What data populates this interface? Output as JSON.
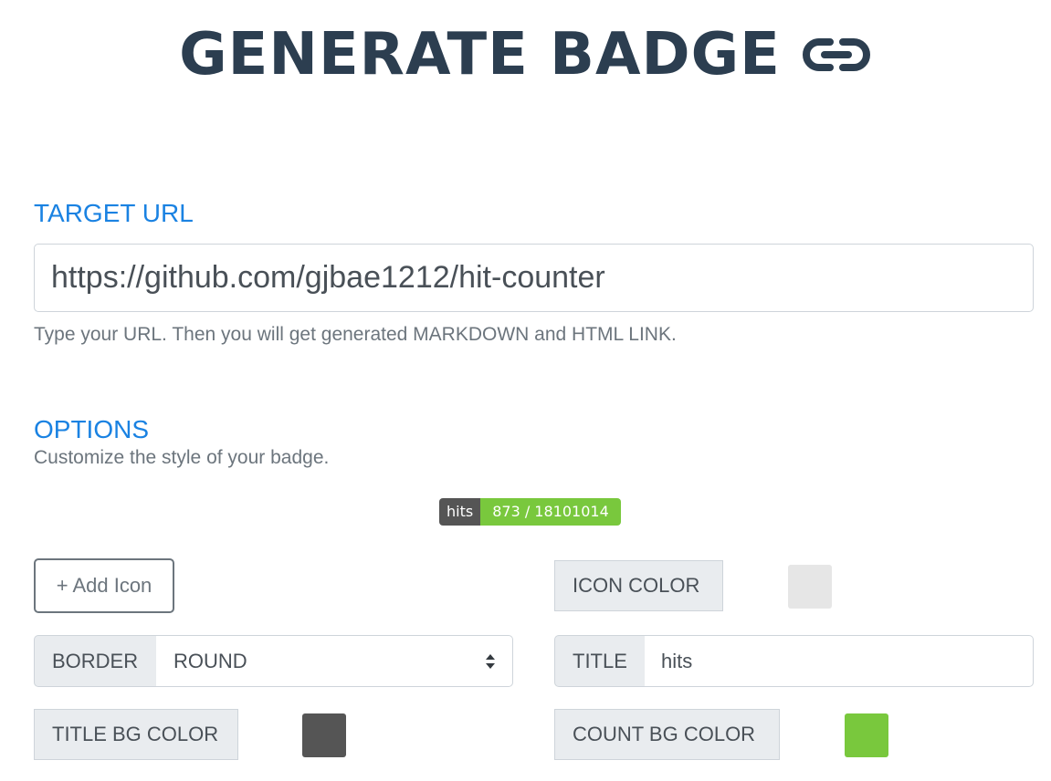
{
  "header": {
    "title": "GENERATE BADGE",
    "icon": "link-icon"
  },
  "target": {
    "label": "TARGET URL",
    "url_value": "https://github.com/gjbae1212/hit-counter",
    "help": "Type your URL. Then you will get generated MARKDOWN and HTML LINK."
  },
  "options": {
    "label": "OPTIONS",
    "help": "Customize the style of your badge."
  },
  "badge": {
    "title": "hits",
    "count": "873 / 18101014",
    "title_color": "#555555",
    "count_color": "#79c83d"
  },
  "controls": {
    "add_icon_label": "+ Add Icon",
    "icon_color_label": "ICON COLOR",
    "icon_color": "#e6e6e6",
    "border_label": "BORDER",
    "border_value": "ROUND",
    "title_label": "TITLE",
    "title_value": "hits",
    "title_bg_label": "TITLE BG COLOR",
    "title_bg_color": "#555555",
    "count_bg_label": "COUNT BG COLOR",
    "count_bg_color": "#79c83d"
  }
}
